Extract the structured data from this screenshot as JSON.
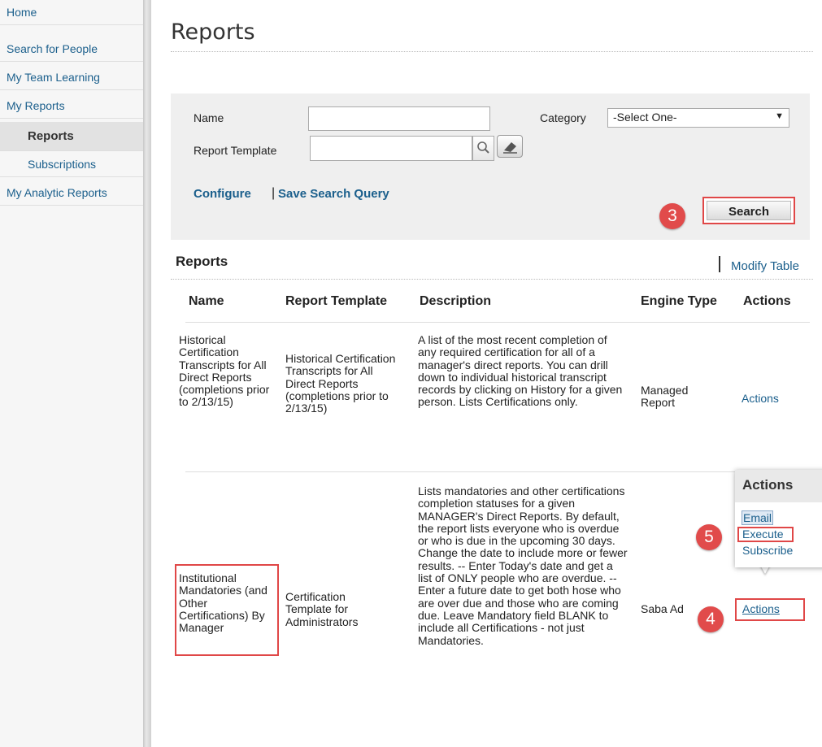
{
  "sidebar": {
    "items": [
      {
        "label": "Home"
      },
      {
        "label": "Search for People"
      },
      {
        "label": "My Team Learning"
      },
      {
        "label": "My Reports"
      },
      {
        "label": "Reports"
      },
      {
        "label": "Subscriptions"
      },
      {
        "label": "My Analytic Reports"
      }
    ]
  },
  "page": {
    "title": "Reports"
  },
  "search": {
    "name_label": "Name",
    "name_value": "",
    "template_label": "Report Template",
    "template_value": "",
    "category_label": "Category",
    "category_selected": "-Select One-",
    "configure_label": "Configure",
    "save_query_label": "Save Search Query",
    "search_label": "Search"
  },
  "reports": {
    "section_title": "Reports",
    "modify_label": "Modify Table",
    "columns": [
      "Name",
      "Report Template",
      "Description",
      "Engine Type",
      "Actions"
    ],
    "rows": [
      {
        "name": "Historical Certification Transcripts for All Direct Reports (completions prior to 2/13/15)",
        "template": "Historical Certification Transcripts for All Direct Reports (completions prior to 2/13/15)",
        "description": "A list of the most recent completion of any required certification for all of a manager's direct reports. You can drill down to individual historical transcript records by clicking on History for a given person. Lists Certifications only.",
        "engine": "Managed Report",
        "action": "Actions"
      },
      {
        "name": "Institutional Mandatories (and Other Certifications) By Manager",
        "template": "Certification Template for Administrators",
        "description": "Lists mandatories and other certifications completion statuses for a given MANAGER's Direct Reports. By default, the report lists everyone who is overdue or who is due in the upcoming 30 days. Change the date to include more or fewer results.  -- Enter Today's date and get a list of ONLY people who are overdue. -- Enter a future date to get both hose who are over due and those who are coming due.  Leave Mandatory field BLANK to include all Certifications - not just Mandatories.",
        "engine": "Saba Ad",
        "action": "Actions"
      }
    ]
  },
  "actions_menu": {
    "title": "Actions",
    "items": [
      "Email",
      "Execute",
      "Subscribe"
    ]
  },
  "badges": [
    "3",
    "4",
    "5"
  ],
  "colors": {
    "link": "#1b5f8c",
    "highlight": "#e04747",
    "badge": "#e14b4b"
  }
}
